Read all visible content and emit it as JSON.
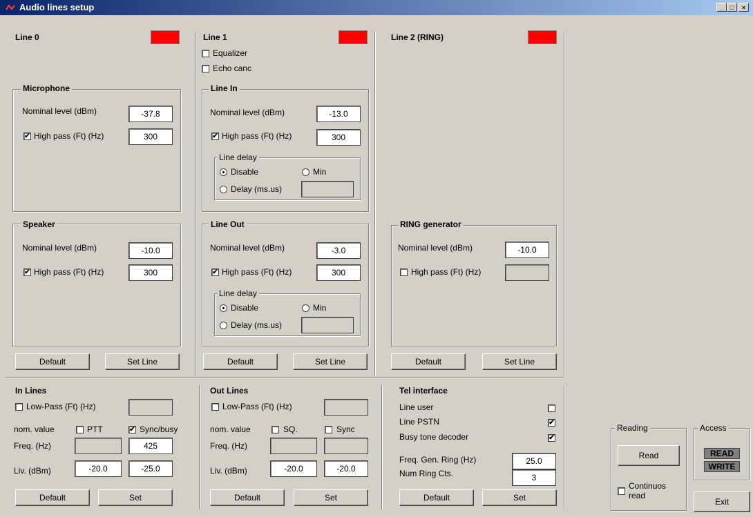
{
  "window": {
    "title": "Audio lines setup"
  },
  "line0": {
    "title": "Line 0",
    "status_color": "#ff0000",
    "mic": {
      "title": "Microphone",
      "nominal_label": "Nominal level  (dBm)",
      "nominal_value": "-37.8",
      "highpass_label": "High pass (Ft)  (Hz)",
      "highpass_checked": "✔",
      "highpass_value": "300"
    },
    "spk": {
      "title": "Speaker",
      "nominal_label": "Nominal level  (dBm)",
      "nominal_value": "-10.0",
      "highpass_label": "High pass (Ft)  (Hz)",
      "highpass_checked": "✔",
      "highpass_value": "300"
    },
    "default_btn": "Default",
    "setline_btn": "Set Line"
  },
  "line1": {
    "title": "Line 1",
    "status_color": "#ff0000",
    "equalizer_label": "Equalizer",
    "echo_label": "Echo canc",
    "linein": {
      "title": "Line In",
      "nominal_label": "Nominal level  (dBm)",
      "nominal_value": "-13.0",
      "highpass_label": "High pass (Ft)  (Hz)",
      "highpass_checked": "✔",
      "highpass_value": "300",
      "delay_title": "Line delay",
      "disable_label": "Disable",
      "min_label": "Min",
      "delay_label": "Delay (ms.us)",
      "delay_value": ""
    },
    "lineout": {
      "title": "Line Out",
      "nominal_label": "Nominal level  (dBm)",
      "nominal_value": "-3.0",
      "highpass_label": "High pass (Ft)  (Hz)",
      "highpass_checked": "✔",
      "highpass_value": "300",
      "delay_title": "Line delay",
      "disable_label": "Disable",
      "min_label": "Min",
      "delay_label": "Delay (ms.us)",
      "delay_value": ""
    },
    "default_btn": "Default",
    "setline_btn": "Set Line"
  },
  "line2": {
    "title": "Line 2 (RING)",
    "status_color": "#ff0000",
    "ring": {
      "title": "RING generator",
      "nominal_label": "Nominal level  (dBm)",
      "nominal_value": "-10.0",
      "highpass_label": "High pass (Ft)  (Hz)",
      "highpass_value": ""
    },
    "default_btn": "Default",
    "setline_btn": "Set Line"
  },
  "inlines": {
    "title": "In Lines",
    "lowpass_label": "Low-Pass (Ft)  (Hz)",
    "lowpass_value": "",
    "nom_label": "nom. value",
    "ptt_label": "PTT",
    "sync_label": "Sync/busy",
    "sync_checked": "✔",
    "freq_label": "Freq.  (Hz)",
    "freq_left": "",
    "freq_right": "425",
    "liv_label": "Liv.  (dBm)",
    "liv_left": "-20.0",
    "liv_right": "-25.0",
    "default_btn": "Default",
    "set_btn": "Set"
  },
  "outlines": {
    "title": "Out Lines",
    "lowpass_label": "Low-Pass (Ft)  (Hz)",
    "lowpass_value": "",
    "nom_label": "nom. value",
    "sq_label": "SQ.",
    "sync_label": "Sync",
    "freq_label": "Freq.  (Hz)",
    "freq_left": "",
    "freq_right": "",
    "liv_label": "Liv.  (dBm)",
    "liv_left": "-20.0",
    "liv_right": "-20.0",
    "default_btn": "Default",
    "set_btn": "Set"
  },
  "tel": {
    "title": "Tel interface",
    "line_user_label": "Line user",
    "line_user_checked": "",
    "line_pstn_label": "Line PSTN",
    "line_pstn_checked": "✔",
    "busy_label": "Busy tone decoder",
    "busy_checked": "✔",
    "freq_ring_label": "Freq. Gen. Ring  (Hz)",
    "freq_ring_value": "25.0",
    "num_ring_label": "Num Ring Cts.",
    "num_ring_value": "3",
    "default_btn": "Default",
    "set_btn": "Set"
  },
  "reading": {
    "title": "Reading",
    "read_btn": "Read",
    "continuos_label": "Continuos read"
  },
  "access": {
    "title": "Access",
    "read": "READ",
    "write": "WRITE"
  },
  "exit_btn": "Exit"
}
